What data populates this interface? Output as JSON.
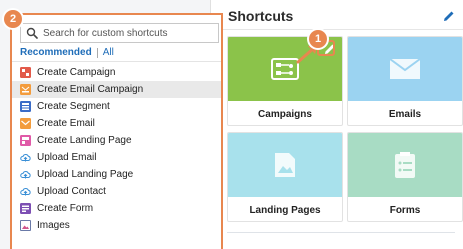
{
  "shortcuts": {
    "title": "Shortcuts",
    "tiles": [
      {
        "label": "Campaigns",
        "color": "#8bc34a"
      },
      {
        "label": "Emails",
        "color": "#9bd3f1"
      },
      {
        "label": "Landing Pages",
        "color": "#a8e1ec"
      },
      {
        "label": "Forms",
        "color": "#a8dcc4"
      }
    ]
  },
  "callouts": {
    "badge_1": "1",
    "badge_2": "2",
    "color": "#e8874f"
  },
  "popup": {
    "search_placeholder": "Search for custom shortcuts",
    "tab_recommended": "Recommended",
    "tab_all": "All",
    "items": [
      {
        "label": "Create Campaign",
        "icon": "campaign-icon",
        "color": "#e25a4a"
      },
      {
        "label": "Create Email Campaign",
        "icon": "email-campaign-icon",
        "color": "#f39c3d"
      },
      {
        "label": "Create Segment",
        "icon": "segment-icon",
        "color": "#3b6cc7"
      },
      {
        "label": "Create Email",
        "icon": "email-icon",
        "color": "#f39c3d"
      },
      {
        "label": "Create Landing Page",
        "icon": "landing-page-icon",
        "color": "#e05aa8"
      },
      {
        "label": "Upload Email",
        "icon": "upload-cloud-icon",
        "color": "#3a8fd6"
      },
      {
        "label": "Upload Landing Page",
        "icon": "upload-cloud-icon",
        "color": "#3a8fd6"
      },
      {
        "label": "Upload Contact",
        "icon": "upload-cloud-icon",
        "color": "#3a8fd6"
      },
      {
        "label": "Create Form",
        "icon": "form-icon",
        "color": "#7d4fb3"
      },
      {
        "label": "Images",
        "icon": "image-icon",
        "color": "#6a7aa8"
      }
    ]
  }
}
